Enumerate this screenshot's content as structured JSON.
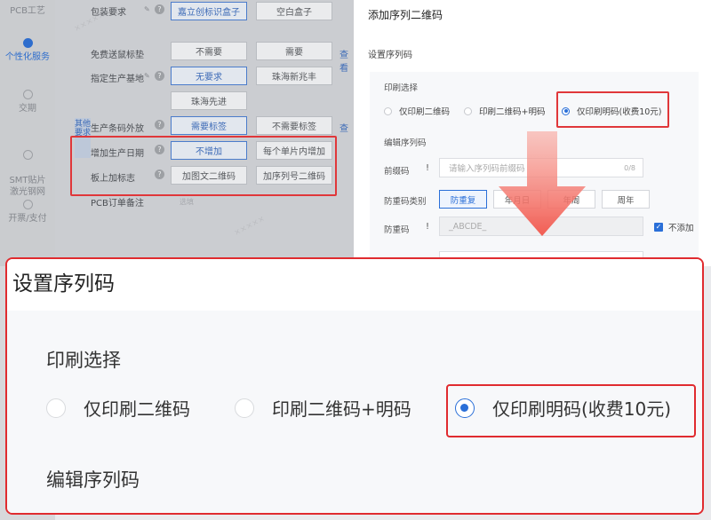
{
  "sidebar": {
    "items": [
      {
        "label": "PCB工艺",
        "active": false
      },
      {
        "label": "个性化服务",
        "active": true
      },
      {
        "label": "交期",
        "active": false
      },
      {
        "label": "SMT贴片\n激光钢网",
        "active": false
      },
      {
        "label": "开票/支付",
        "active": false
      }
    ]
  },
  "form": {
    "side_tab": "其他要求",
    "rows": {
      "packaging": {
        "label": "包装要求",
        "options": [
          "嘉立创标识盒子",
          "空白盒子"
        ],
        "selected": 0
      },
      "mouse_pad": {
        "label": "免费送鼠标垫",
        "options": [
          "不需要",
          "需要"
        ],
        "link": "查看"
      },
      "base": {
        "label": "指定生产基地",
        "options": [
          "无要求",
          "珠海新兆丰",
          "珠海先进"
        ],
        "selected": 0
      },
      "barcode": {
        "label": "生产条码外放",
        "options": [
          "需要标签",
          "不需要标签"
        ],
        "selected": 0,
        "link": "查"
      },
      "date": {
        "label": "增加生产日期",
        "options": [
          "不增加",
          "每个单片内增加"
        ],
        "selected": 0
      },
      "marking": {
        "label": "板上加标志",
        "options": [
          "加图文二维码",
          "加序列号二维码"
        ]
      },
      "remark": {
        "label": "PCB订单备注",
        "placeholder": "选填"
      }
    }
  },
  "drawer": {
    "title": "添加序列二维码",
    "section_title": "设置序列码",
    "print_label": "印刷选择",
    "print_options": [
      "仅印刷二维码",
      "印刷二维码+明码",
      "仅印刷明码(收费10元)"
    ],
    "print_selected": 2,
    "edit_label": "编辑序列码",
    "prefix_label": "前缀码",
    "prefix_placeholder": "请输入序列码前缀码",
    "prefix_counter": "0/8",
    "anti_dup_label": "防重码类别",
    "anti_dup_options": [
      "防重复",
      "年月日",
      "年周",
      "周年"
    ],
    "anti_dup_selected": 0,
    "anti_code_label": "防重码",
    "anti_code_value": "_ABCDE_",
    "no_add_label": "不添加",
    "no_add_checked": true
  },
  "zoom": {
    "title": "设置序列码",
    "print_label": "印刷选择",
    "print_options": [
      "仅印刷二维码",
      "印刷二维码+明码",
      "仅印刷明码(收费10元)"
    ],
    "print_selected": 2,
    "edit_label": "编辑序列码"
  },
  "colors": {
    "accent": "#2a6fd8",
    "highlight": "#e0373a",
    "arrow": "#f2564b"
  }
}
